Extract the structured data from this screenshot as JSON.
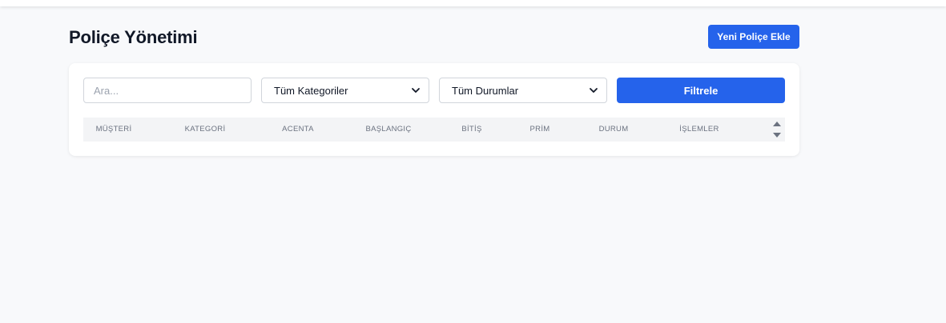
{
  "header": {
    "title": "Poliçe Yönetimi",
    "add_button_label": "Yeni Poliçe Ekle"
  },
  "filters": {
    "search_placeholder": "Ara...",
    "category_selected": "Tüm Kategoriler",
    "status_selected": "Tüm Durumlar",
    "filter_button_label": "Filtrele"
  },
  "table": {
    "columns": [
      "MÜŞTERİ",
      "KATEGORİ",
      "ACENTA",
      "BAŞLANGIÇ",
      "BİTİŞ",
      "PRİM",
      "DURUM",
      "İŞLEMLER"
    ]
  },
  "colors": {
    "accent": "#2563eb",
    "background": "#f8f9fb"
  }
}
